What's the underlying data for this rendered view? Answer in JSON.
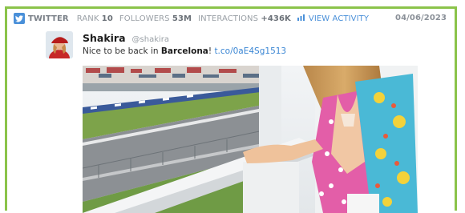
{
  "header": {
    "platform": "TWITTER",
    "rank_label": "RANK",
    "rank_value": "10",
    "followers_label": "FOLLOWERS",
    "followers_value": "53M",
    "interactions_label": "INTERACTIONS",
    "interactions_value": "+436K",
    "view_activity": "VIEW ACTIVITY",
    "date": "04/06/2023"
  },
  "tweet": {
    "name": "Shakira",
    "handle": "@shakira",
    "text_before": "Nice to be back in ",
    "text_bold": "Barcelona",
    "text_after": "! ",
    "link": "t.co/0aE4Sg1513"
  },
  "colors": {
    "accent_green": "#8bc34a",
    "link_blue": "#3a86d4",
    "twitter_blue": "#4a90d9"
  },
  "icons": [
    "twitter-icon",
    "bar-chart-icon"
  ]
}
